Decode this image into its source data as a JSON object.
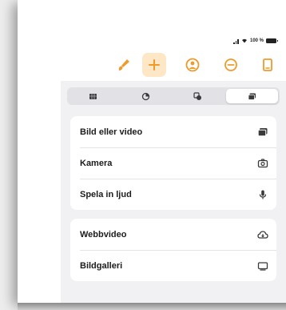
{
  "status_bar": {
    "battery_text": "100 %",
    "icons": [
      "signal-icon",
      "wifi-icon",
      "battery-icon"
    ]
  },
  "toolbar": {
    "items": [
      {
        "name": "brush-tool",
        "icon": "paintbrush-icon",
        "active": false
      },
      {
        "name": "insert",
        "icon": "plus-icon",
        "active": true
      },
      {
        "name": "collaborate",
        "icon": "person-add-icon",
        "active": false
      },
      {
        "name": "format",
        "icon": "circle-minus-icon",
        "active": false
      },
      {
        "name": "document",
        "icon": "document-icon",
        "active": false
      }
    ]
  },
  "segmented_control": {
    "tabs": [
      {
        "icon": "table-icon",
        "selected": false
      },
      {
        "icon": "chart-icon",
        "selected": false
      },
      {
        "icon": "shapes-icon",
        "selected": false
      },
      {
        "icon": "media-icon",
        "selected": true
      }
    ]
  },
  "menu": {
    "group1": [
      {
        "label": "Bild eller video",
        "icon": "photo-icon"
      },
      {
        "label": "Kamera",
        "icon": "camera-icon"
      },
      {
        "label": "Spela in ljud",
        "icon": "mic-icon"
      }
    ],
    "group2": [
      {
        "label": "Webbvideo",
        "icon": "cloud-icon"
      },
      {
        "label": "Bildgalleri",
        "icon": "gallery-icon"
      }
    ]
  },
  "colors": {
    "accent": "#f09a2b",
    "icon_gray": "#3a3a3c",
    "active_bg": "#fde7c6"
  }
}
